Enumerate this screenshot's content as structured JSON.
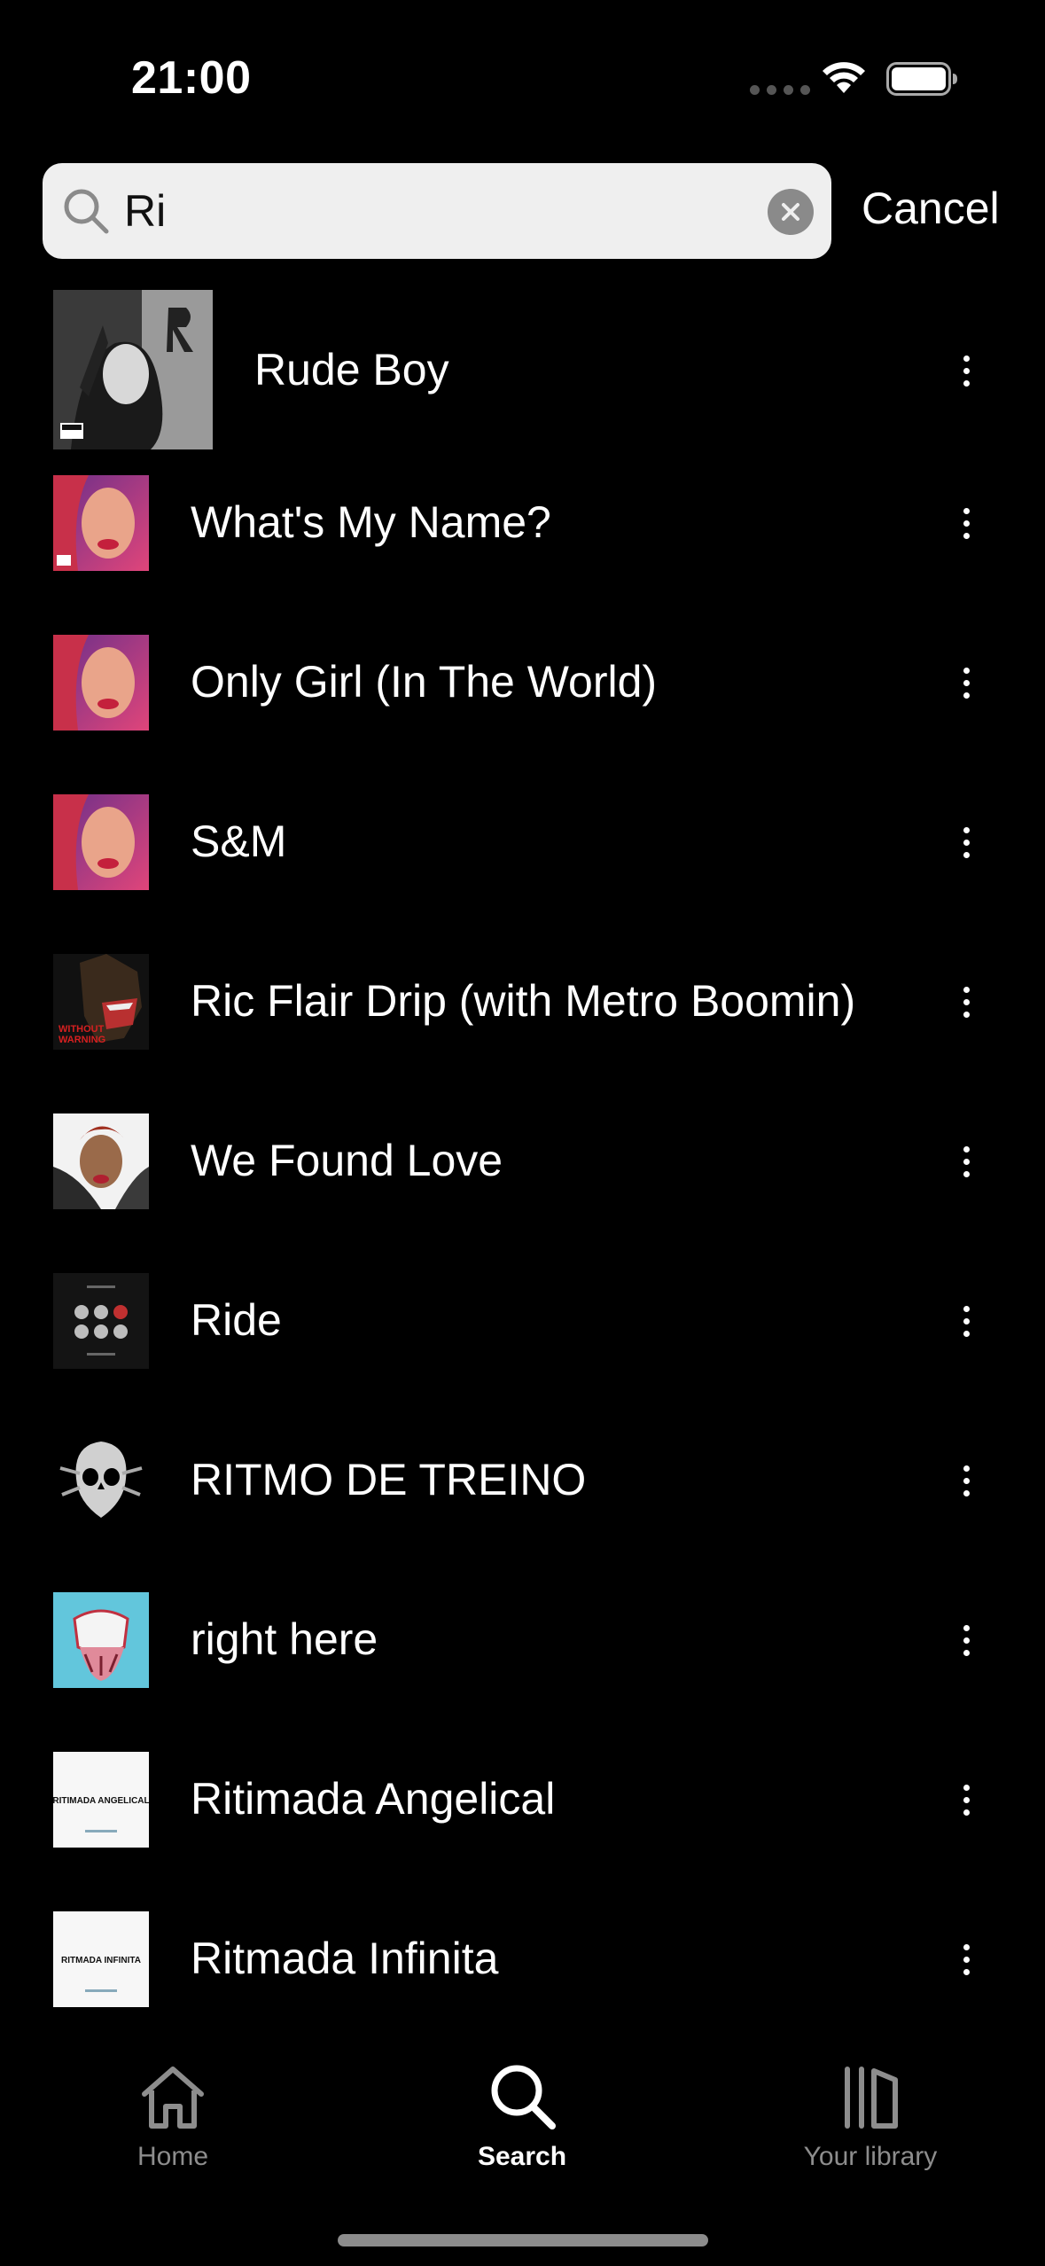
{
  "status_bar": {
    "time": "21:00"
  },
  "search": {
    "query": "Ri",
    "cancel_label": "Cancel"
  },
  "results": [
    {
      "title": "Rude Boy",
      "art": "rated-r"
    },
    {
      "title": "What's My Name?",
      "art": "loud"
    },
    {
      "title": "Only Girl (In The World)",
      "art": "loud"
    },
    {
      "title": "S&M",
      "art": "loud"
    },
    {
      "title": "Ric Flair Drip (with Metro Boomin)",
      "art": "without-warning",
      "art_text": "WITHOUT WARNING"
    },
    {
      "title": "We Found Love",
      "art": "talk-that-talk"
    },
    {
      "title": "Ride",
      "art": "blurryface"
    },
    {
      "title": "RITMO DE TREINO",
      "art": "skull"
    },
    {
      "title": "right here",
      "art": "cartoon"
    },
    {
      "title": "Ritimada Angelical",
      "art": "text-cover",
      "art_text": "RITIMADA ANGELICAL"
    },
    {
      "title": "Ritmada Infinita",
      "art": "text-cover",
      "art_text": "RITMADA INFINITA"
    }
  ],
  "tabs": [
    {
      "label": "Home",
      "icon": "home-icon",
      "active": false
    },
    {
      "label": "Search",
      "icon": "search-icon",
      "active": true
    },
    {
      "label": "Your library",
      "icon": "library-icon",
      "active": false
    }
  ],
  "colors": {
    "background": "#000000",
    "search_field": "#efefef",
    "inactive_tab": "#8d8d8d"
  }
}
